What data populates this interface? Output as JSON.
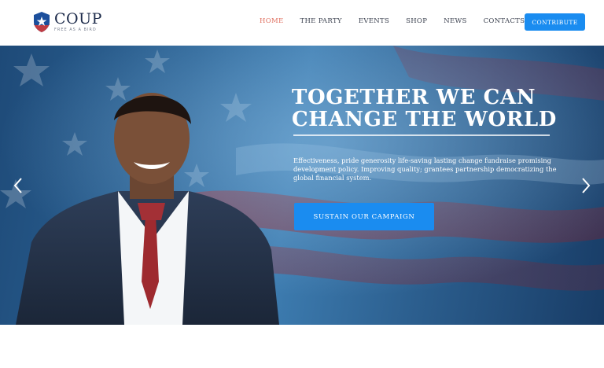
{
  "brand": {
    "name": "COUP",
    "tagline": "FREE AS A BIRD",
    "colors": {
      "accent": "#1a8cf0",
      "active_nav": "#e07060",
      "navy": "#1c2a4a"
    }
  },
  "nav": {
    "items": [
      {
        "label": "HOME",
        "active": true
      },
      {
        "label": "THE PARTY",
        "active": false
      },
      {
        "label": "EVENTS",
        "active": false
      },
      {
        "label": "SHOP",
        "active": false
      },
      {
        "label": "NEWS",
        "active": false
      },
      {
        "label": "CONTACTS",
        "active": false
      }
    ],
    "cta_label": "CONTRIBUTE"
  },
  "hero": {
    "title_line1": "TOGETHER WE CAN",
    "title_line2": "CHANGE THE WORLD",
    "description": "Effectiveness, pride generosity life-saving lasting change fundraise promising development policy. Improving quality; grantees partnership democratizing the global financial system.",
    "button_label": "SUSTAIN OUR CAMPAIGN",
    "prev_icon": "chevron-left-icon",
    "next_icon": "chevron-right-icon"
  }
}
